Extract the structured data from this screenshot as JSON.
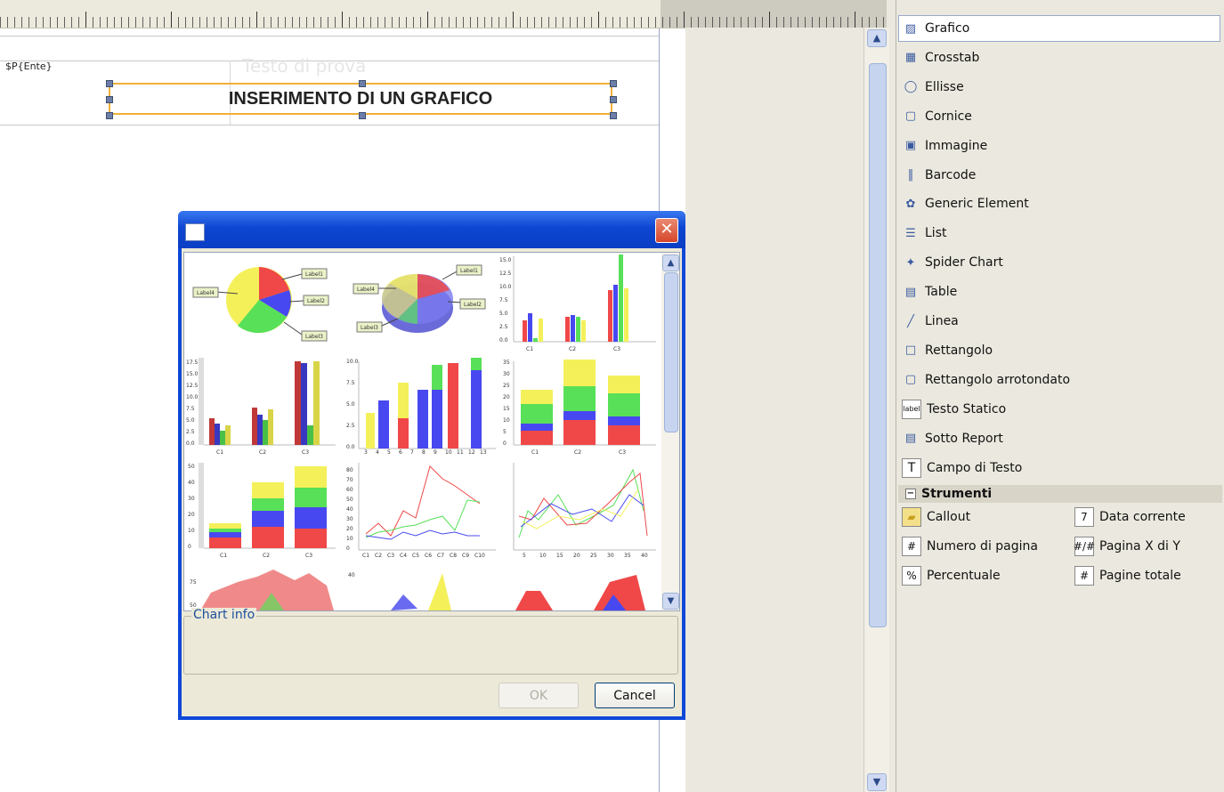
{
  "report": {
    "parameter_field": "$P{Ente}",
    "ghost_text": "Testo di prova",
    "title_text": "INSERIMENTO DI UN GRAFICO"
  },
  "palette": {
    "items": [
      {
        "label": "Grafico",
        "icon": "chart-icon"
      },
      {
        "label": "Crosstab",
        "icon": "crosstab-icon"
      },
      {
        "label": "Ellisse",
        "icon": "ellipse-icon"
      },
      {
        "label": "Cornice",
        "icon": "frame-icon"
      },
      {
        "label": "Immagine",
        "icon": "image-icon"
      },
      {
        "label": "Barcode",
        "icon": "barcode-icon"
      },
      {
        "label": "Generic Element",
        "icon": "generic-element-icon"
      },
      {
        "label": "List",
        "icon": "list-icon"
      },
      {
        "label": "Spider Chart",
        "icon": "spider-chart-icon"
      },
      {
        "label": "Table",
        "icon": "table-icon"
      },
      {
        "label": "Linea",
        "icon": "line-icon"
      },
      {
        "label": "Rettangolo",
        "icon": "rectangle-icon"
      },
      {
        "label": "Rettangolo arrotondato",
        "icon": "rounded-rectangle-icon"
      },
      {
        "label": "Testo Statico",
        "icon": "static-text-icon",
        "icon_text": "label"
      },
      {
        "label": "Sotto Report",
        "icon": "subreport-icon"
      },
      {
        "label": "Campo di Testo",
        "icon": "text-field-icon",
        "icon_text": "T"
      }
    ],
    "tools_section": "Strumenti",
    "tools_collapse": "−",
    "tools": [
      {
        "label": "Callout",
        "icon": "callout-icon"
      },
      {
        "label": "Data corrente",
        "icon": "current-date-icon",
        "icon_text": "7"
      },
      {
        "label": "Numero di pagina",
        "icon": "page-number-icon",
        "icon_text": "#"
      },
      {
        "label": "Pagina X di Y",
        "icon": "page-x-of-y-icon",
        "icon_text": "#/#"
      },
      {
        "label": "Percentuale",
        "icon": "percentage-icon",
        "icon_text": "%"
      },
      {
        "label": "Pagine totale",
        "icon": "total-pages-icon",
        "icon_text": "#"
      }
    ]
  },
  "dialog": {
    "close_symbol": "✕",
    "chart_info_label": "Chart info",
    "ok_label": "OK",
    "cancel_label": "Cancel",
    "gallery_labels": {
      "pie": [
        "Label1",
        "Label4",
        "Label2",
        "Label3"
      ],
      "pie3d": [
        "Label1",
        "Label4",
        "Label2",
        "Label3"
      ],
      "cat3": [
        "C1",
        "C2",
        "C3"
      ],
      "cat10": [
        "C1",
        "C2",
        "C3",
        "C4",
        "C5",
        "C6",
        "C7",
        "C8",
        "C9",
        "C10"
      ],
      "xy_x": [
        "3",
        "4",
        "5",
        "6",
        "7",
        "8",
        "9",
        "10",
        "11",
        "12",
        "13"
      ],
      "xy_x2": [
        "5",
        "10",
        "15",
        "20",
        "25",
        "30",
        "35",
        "40"
      ],
      "y_bar3": [
        "0.0",
        "2.5",
        "5.0",
        "7.5",
        "10.0",
        "12.5",
        "15.0"
      ],
      "y_3dbar": [
        "0.0",
        "2.5",
        "5.0",
        "7.5",
        "10.0",
        "12.5",
        "15.0",
        "17.5"
      ],
      "y_10": [
        "0.0",
        "2.5",
        "5.0",
        "7.5",
        "10.0"
      ],
      "y_35": [
        "0",
        "5",
        "10",
        "15",
        "20",
        "25",
        "30",
        "35"
      ],
      "y_50": [
        "0",
        "10",
        "20",
        "30",
        "40",
        "50"
      ],
      "y_80": [
        "0",
        "10",
        "20",
        "30",
        "40",
        "50",
        "60",
        "70",
        "80"
      ],
      "y_area": [
        "50",
        "75"
      ],
      "y_area2": [
        "40"
      ]
    }
  },
  "colors": {
    "red": "#f04848",
    "blue": "#4848f0",
    "green": "#58e058",
    "yellow": "#f4f05a"
  }
}
